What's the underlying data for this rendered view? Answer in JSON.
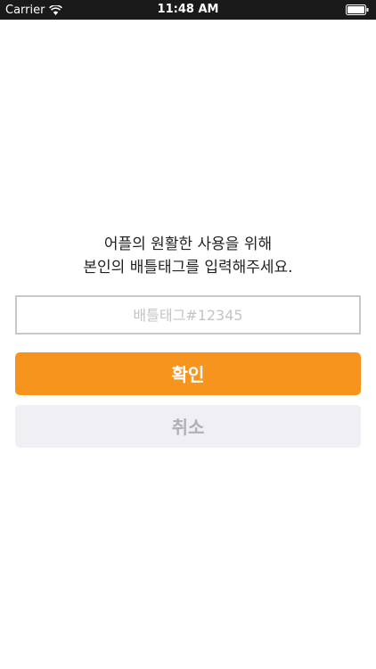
{
  "status_bar": {
    "carrier": "Carrier",
    "time": "11:48 AM"
  },
  "prompt": {
    "line1": "어플의 원활한 사용을 위해",
    "line2": "본인의 배틀태그를 입력해주세요."
  },
  "battletag_input": {
    "value": "",
    "placeholder": "배틀태그#12345"
  },
  "buttons": {
    "confirm_label": "확인",
    "cancel_label": "취소"
  },
  "colors": {
    "accent": "#f7941d",
    "cancel_bg": "#efeff4",
    "status_bar_bg": "#1a1a1a"
  }
}
